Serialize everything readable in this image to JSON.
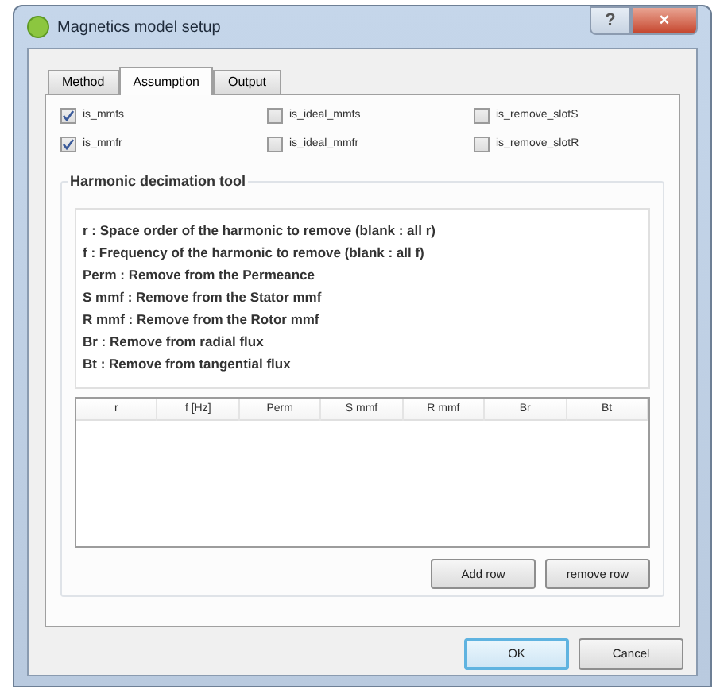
{
  "window": {
    "title": "Magnetics model setup",
    "buttons": [
      {
        "kind": "help",
        "label": "?"
      },
      {
        "kind": "close",
        "label": "×"
      }
    ]
  },
  "tabs": [
    {
      "label": "Method",
      "selected": false
    },
    {
      "label": "Assumption",
      "selected": true
    },
    {
      "label": "Output",
      "selected": false
    }
  ],
  "options": [
    {
      "label": "is_mmfs",
      "checked": true
    },
    {
      "label": "is_ideal_mmfs",
      "checked": false
    },
    {
      "label": "is_remove_slotS",
      "checked": false
    },
    {
      "label": "is_mmfr",
      "checked": true
    },
    {
      "label": "is_ideal_mmfr",
      "checked": false
    },
    {
      "label": "is_remove_slotR",
      "checked": false
    }
  ],
  "group": {
    "title": "Harmonic decimation tool",
    "help_lines": [
      "r : Space order of the harmonic to remove (blank : all r)",
      "f : Frequency of the harmonic to remove (blank : all f)",
      "Perm : Remove from the Permeance",
      "S mmf : Remove from the Stator mmf",
      "R mmf : Remove from the Rotor mmf",
      "Br : Remove from radial flux",
      "Bt : Remove from tangential flux"
    ],
    "table": {
      "columns": [
        "r",
        "f [Hz]",
        "Perm",
        "S mmf",
        "R mmf",
        "Br",
        "Bt"
      ]
    },
    "buttons": [
      "Add row",
      "remove row"
    ]
  },
  "dialog_buttons": [
    {
      "label": "OK",
      "default": true
    },
    {
      "label": "Cancel",
      "default": false
    }
  ]
}
